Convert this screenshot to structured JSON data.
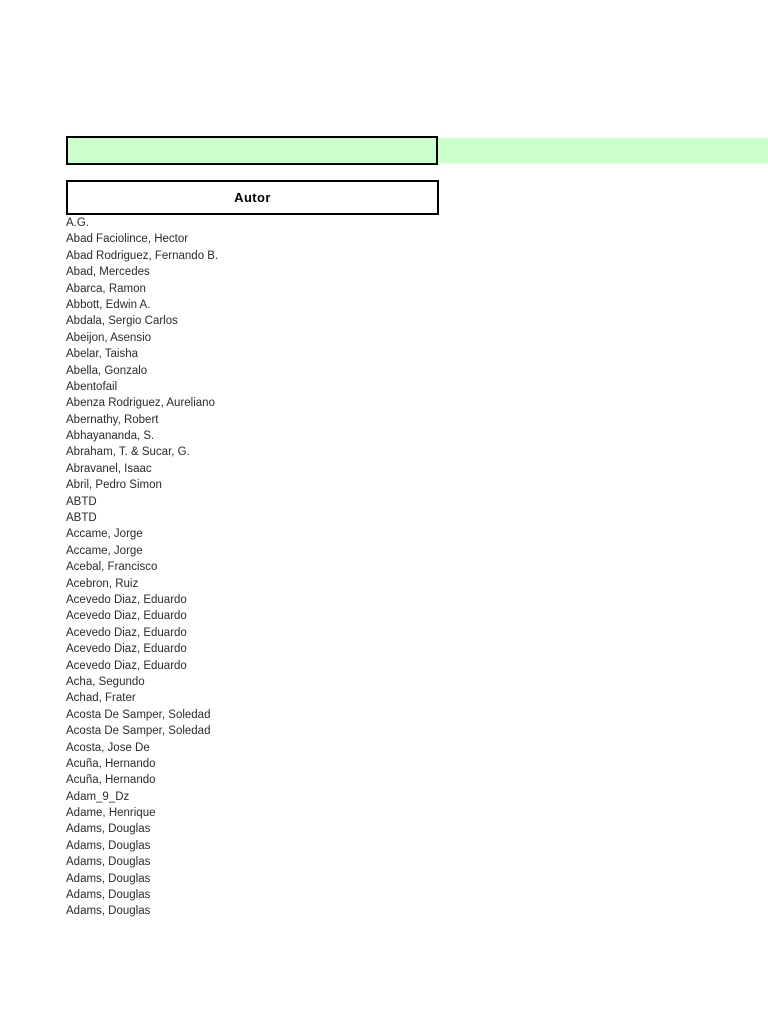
{
  "colors": {
    "banner_green": "#ccffcc",
    "border_black": "#000000",
    "text": "#2b2b2b"
  },
  "banner": {
    "value": ""
  },
  "table": {
    "header": {
      "column_label": "Autor"
    },
    "rows": [
      "A.G.",
      "Abad Faciolince, Hector",
      "Abad Rodriguez, Fernando B.",
      "Abad, Mercedes",
      "Abarca, Ramon",
      "Abbott, Edwin A.",
      "Abdala, Sergio Carlos",
      "Abeijon, Asensio",
      "Abelar, Taisha",
      "Abella, Gonzalo",
      "Abentofail",
      "Abenza Rodriguez, Aureliano",
      "Abernathy, Robert",
      "Abhayananda, S.",
      "Abraham, T. & Sucar, G.",
      "Abravanel, Isaac",
      "Abril, Pedro Simon",
      "ABTD",
      "ABTD",
      "Accame, Jorge",
      "Accame, Jorge",
      "Acebal, Francisco",
      "Acebron, Ruiz",
      "Acevedo Diaz, Eduardo",
      "Acevedo Diaz, Eduardo",
      "Acevedo Diaz, Eduardo",
      "Acevedo Diaz, Eduardo",
      "Acevedo Diaz, Eduardo",
      "Acha, Segundo",
      "Achad, Frater",
      "Acosta De Samper, Soledad",
      "Acosta De Samper, Soledad",
      "Acosta, Jose De",
      "Acuña, Hernando",
      "Acuña, Hernando",
      "Adam_9_Dz",
      "Adame, Henrique",
      "Adams, Douglas",
      "Adams, Douglas",
      "Adams, Douglas",
      "Adams, Douglas",
      "Adams, Douglas",
      "Adams, Douglas"
    ]
  }
}
